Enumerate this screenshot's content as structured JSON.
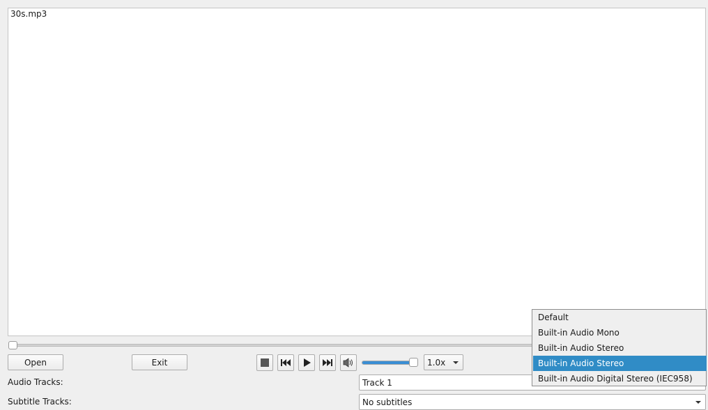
{
  "player": {
    "file_title": "30s.mp3",
    "position_fraction": 0.0,
    "volume_fraction": 0.92
  },
  "buttons": {
    "open_label": "Open",
    "exit_label": "Exit"
  },
  "transport": {
    "stop_icon": "stop-icon",
    "previous_icon": "skip-back-icon",
    "play_icon": "play-icon",
    "next_icon": "skip-forward-icon",
    "mute_icon": "speaker-icon"
  },
  "speed": {
    "value": "1.0x"
  },
  "audio_tracks": {
    "label": "Audio Tracks:",
    "value": "Track 1"
  },
  "subtitle_tracks": {
    "label": "Subtitle Tracks:",
    "value": "No subtitles"
  },
  "audio_device_popup": {
    "items": [
      "Default",
      "Built-in Audio Mono",
      "Built-in Audio Stereo",
      "Built-in Audio Stereo",
      "Built-in Audio Digital Stereo (IEC958)"
    ],
    "selected_index": 3
  },
  "colors": {
    "accent": "#308cc6",
    "volume_fill": "#3a8ed4"
  }
}
